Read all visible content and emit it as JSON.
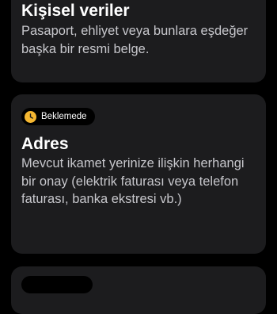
{
  "cards": [
    {
      "title": "Kişisel veriler",
      "description": "Pasaport, ehliyet veya bunlara eşdeğer başka bir resmi belge."
    },
    {
      "status": "Beklemede",
      "status_icon": "clock-icon",
      "status_color": "#f5b731",
      "title": "Adres",
      "description": "Mevcut ikamet yerinize ilişkin herhangi bir onay (elektrik faturası veya telefon faturası, banka ekstresi vb.)"
    }
  ],
  "colors": {
    "background": "#000000",
    "card": "#1c1c1e",
    "text_primary": "#ffffff",
    "text_secondary": "#c7c7cc",
    "pending": "#f5b731"
  }
}
